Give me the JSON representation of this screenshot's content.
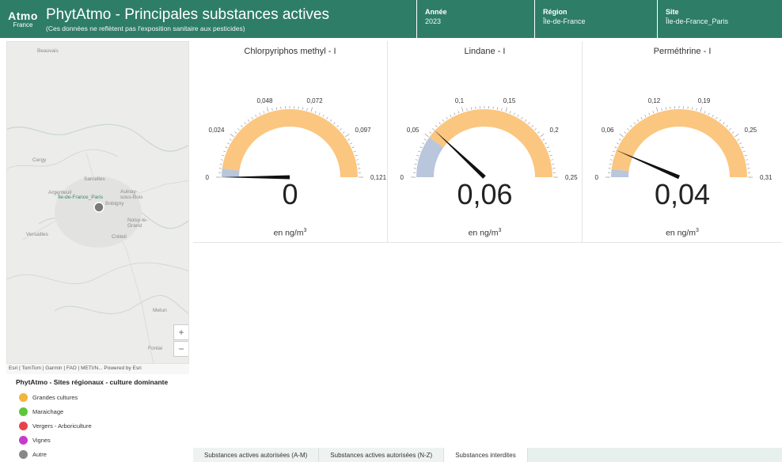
{
  "header": {
    "logo_line1": "Atmo",
    "logo_line2": "France",
    "title": "PhytAtmo - Principales substances actives",
    "subtitle": "(Ces données ne reflètent pas l'exposition sanitaire aux pesticides)",
    "annee_label": "Année",
    "annee_value": "2023",
    "region_label": "Région",
    "region_value": "Île-de-France",
    "site_label": "Site",
    "site_value": "Île-de-France_Paris"
  },
  "map": {
    "labels": [
      "Beauvais",
      "Cergy",
      "Sarcelles",
      "Argenteuil",
      "Île-de-France_Paris",
      "Aulnay-sous-Bois",
      "Bobigny",
      "Noisy-le-Grand",
      "Versailles",
      "Créteil",
      "Melun",
      "Fontai"
    ],
    "zoom_in": "+",
    "zoom_out": "−",
    "attribution": "Esri | TomTom | Garmin | FAO | METI/N...   Powered by Esri",
    "site_color": "#7a7a7a"
  },
  "legend": {
    "title": "PhytAtmo - Sites régionaux - culture dominante",
    "items": [
      {
        "label": "Grandes cultures",
        "color": "#f2b63a"
      },
      {
        "label": "Maraichage",
        "color": "#5cc63c"
      },
      {
        "label": "Vergers - Arboriculture",
        "color": "#e8434b"
      },
      {
        "label": "Vignes",
        "color": "#c63cc8"
      },
      {
        "label": "Autre",
        "color": "#888888"
      }
    ]
  },
  "gauges": [
    {
      "title": "Chlorpyriphos methyl - I",
      "value_text": "0",
      "value": 0,
      "min": 0,
      "max": 0.121,
      "threshold": 0.005,
      "ticks": [
        "0",
        "0,024",
        "0,048",
        "0,072",
        "0,097",
        "0,121"
      ],
      "unit": "en ng/m",
      "unit_sup": "3"
    },
    {
      "title": "Lindane - I",
      "value_text": "0,06",
      "value": 0.06,
      "min": 0,
      "max": 0.25,
      "threshold": 0.05,
      "ticks": [
        "0",
        "0,05",
        "0,1",
        "0,15",
        "0,2",
        "0,25"
      ],
      "unit": "en ng/m",
      "unit_sup": "3"
    },
    {
      "title": "Perméthrine - I",
      "value_text": "0,04",
      "value": 0.04,
      "min": 0,
      "max": 0.31,
      "threshold": 0.012,
      "ticks": [
        "0",
        "0,06",
        "0,12",
        "0,19",
        "0,25",
        "0,31"
      ],
      "unit": "en ng/m",
      "unit_sup": "3"
    }
  ],
  "colors": {
    "header_bg": "#2e7d66",
    "gauge_fill": "#fbc67f",
    "gauge_low": "#b9c6dc",
    "needle": "#111111"
  },
  "tabs": [
    {
      "label": "Substances actives autorisées (A-M)",
      "active": false
    },
    {
      "label": "Substances actives autorisées (N-Z)",
      "active": false
    },
    {
      "label": "Substances interdites",
      "active": true
    }
  ]
}
